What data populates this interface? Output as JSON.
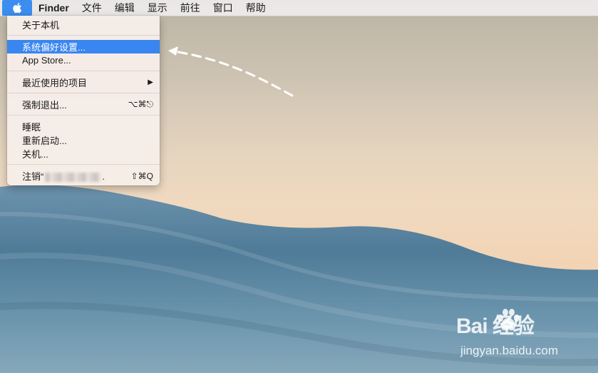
{
  "menubar": {
    "apple_icon": "apple-logo-icon",
    "items": [
      "Finder",
      "文件",
      "编辑",
      "显示",
      "前往",
      "窗口",
      "帮助"
    ]
  },
  "apple_menu": {
    "about": "关于本机",
    "system_prefs": "系统偏好设置...",
    "app_store": "App Store...",
    "recent_items": "最近使用的项目",
    "recent_items_arrow": "▶",
    "force_quit": "强制退出...",
    "force_quit_shortcut": "⌥⌘⎋",
    "sleep": "睡眠",
    "restart": "重新启动...",
    "shutdown": "关机...",
    "logout_prefix": "注销“",
    "logout_suffix": ".",
    "logout_shortcut": "⇧⌘Q"
  },
  "colors": {
    "highlight": "#3a86f0",
    "apple_button": "#3b8ef0"
  },
  "watermark": {
    "logo": "Bai 经验",
    "url": "jingyan.baidu.com"
  }
}
